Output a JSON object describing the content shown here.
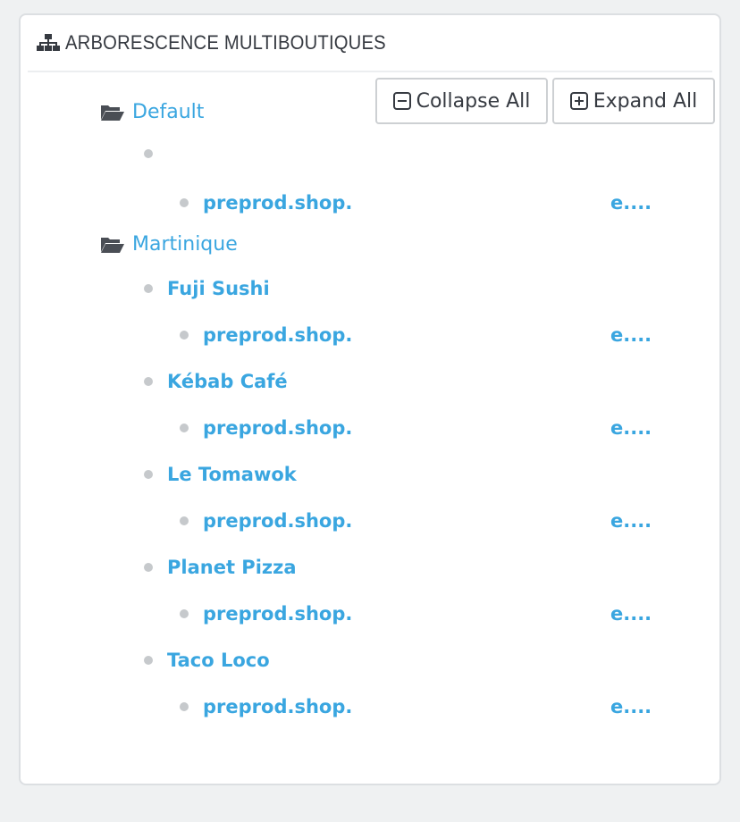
{
  "panel": {
    "title": "ARBORESCENCE MULTIBOUTIQUES",
    "header_icon": "sitemap-icon"
  },
  "toolbar": {
    "collapse_label": "Collapse All",
    "collapse_icon": "minus-square-icon",
    "expand_label": "Expand All",
    "expand_icon": "plus-square-icon"
  },
  "tree": {
    "groups": [
      {
        "label": "Default",
        "icon": "folder-open-icon",
        "shops": [
          {
            "name": "",
            "url_start": "preprod.shop.",
            "url_end": "e...."
          }
        ]
      },
      {
        "label": "Martinique",
        "icon": "folder-open-icon",
        "shops": [
          {
            "name": "Fuji Sushi",
            "url_start": "preprod.shop.",
            "url_end": "e...."
          },
          {
            "name": "Kébab Café",
            "url_start": "preprod.shop.",
            "url_end": "e...."
          },
          {
            "name": "Le Tomawok",
            "url_start": "preprod.shop.",
            "url_end": "e...."
          },
          {
            "name": "Planet Pizza",
            "url_start": "preprod.shop.",
            "url_end": "e...."
          },
          {
            "name": "Taco Loco",
            "url_start": "preprod.shop.",
            "url_end": "e...."
          }
        ]
      }
    ]
  },
  "colors": {
    "link": "#3aa6e0",
    "text": "#363a41",
    "bullet": "#c6c9cc"
  }
}
